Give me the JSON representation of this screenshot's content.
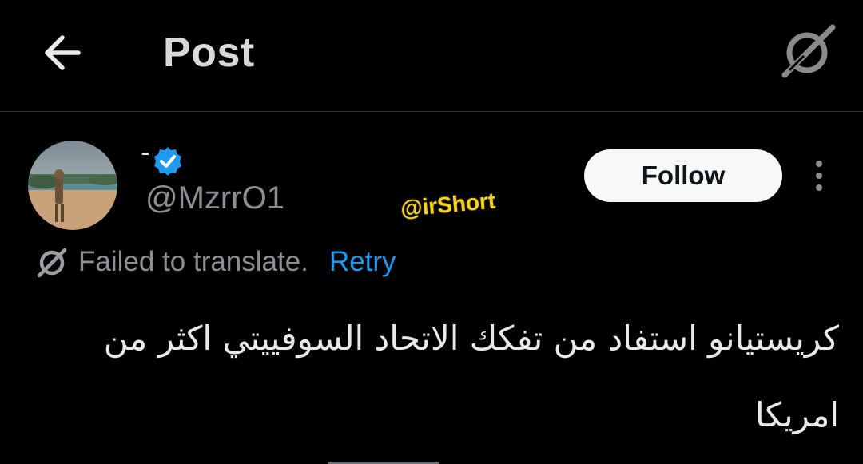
{
  "header": {
    "title": "Post",
    "back_icon": "arrow-left-icon",
    "grok_icon": "grok-icon"
  },
  "author": {
    "display_name": "ـ",
    "handle": "@MzrrO1",
    "verified": true,
    "verified_icon": "verified-badge-icon",
    "follow_label": "Follow",
    "more_icon": "more-vertical-icon"
  },
  "watermark": "@irShort",
  "translation": {
    "status_icon": "translate-failed-icon",
    "status_text": "Failed to translate.",
    "retry_label": "Retry"
  },
  "post": {
    "text": "كريستيانو استفاد من تفكك الاتحاد السوفييتي اكثر من امريكا"
  },
  "colors": {
    "background": "#000000",
    "text": "#e7e9ea",
    "secondary_text": "#8b8f94",
    "accent": "#1d9bf0",
    "watermark": "#f4d21e",
    "follow_bg": "#f7f9f9"
  }
}
